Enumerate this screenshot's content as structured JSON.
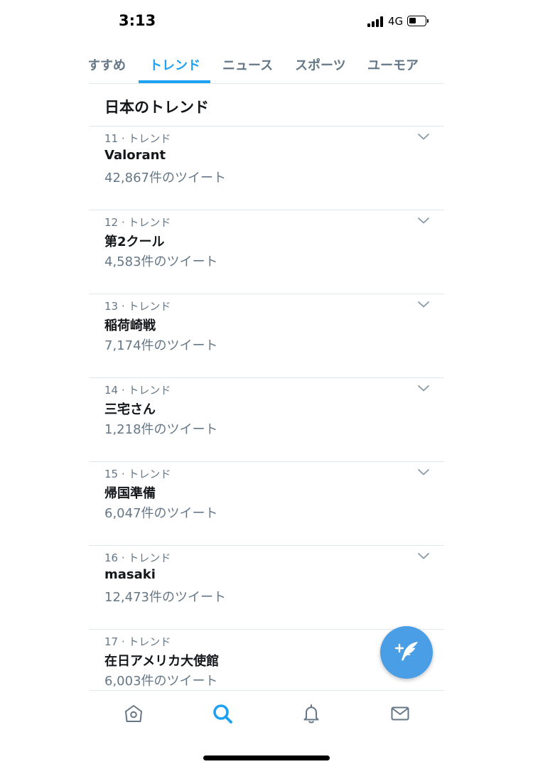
{
  "status_bar": {
    "time": "3:13",
    "network": "4G"
  },
  "tabs": [
    {
      "label": "すすめ",
      "active": false
    },
    {
      "label": "トレンド",
      "active": true
    },
    {
      "label": "ニュース",
      "active": false
    },
    {
      "label": "スポーツ",
      "active": false
    },
    {
      "label": "ユーモア",
      "active": false
    }
  ],
  "section_title": "日本のトレンド",
  "trends": [
    {
      "meta": "11 · トレンド",
      "name": "Valorant",
      "count": "42,867件のツイート"
    },
    {
      "meta": "12 · トレンド",
      "name": "第2クール",
      "count": "4,583件のツイート"
    },
    {
      "meta": "13 · トレンド",
      "name": "稲荷崎戦",
      "count": "7,174件のツイート"
    },
    {
      "meta": "14 · トレンド",
      "name": "三宅さん",
      "count": "1,218件のツイート"
    },
    {
      "meta": "15 · トレンド",
      "name": "帰国準備",
      "count": "6,047件のツイート"
    },
    {
      "meta": "16 · トレンド",
      "name": "masaki",
      "count": "12,473件のツイート"
    },
    {
      "meta": "17 · トレンド",
      "name": "在日アメリカ大使館",
      "count": "6,003件のツイート"
    }
  ],
  "bottom_nav": [
    {
      "icon": "home-icon",
      "active": false
    },
    {
      "icon": "search-icon",
      "active": true
    },
    {
      "icon": "bell-icon",
      "active": false
    },
    {
      "icon": "mail-icon",
      "active": false
    }
  ],
  "fab": {
    "icon": "compose-tweet-icon"
  },
  "colors": {
    "accent": "#1da1f2",
    "fab": "#4a9ee6",
    "secondary_text": "#657786",
    "divider": "#e1e8ed"
  }
}
